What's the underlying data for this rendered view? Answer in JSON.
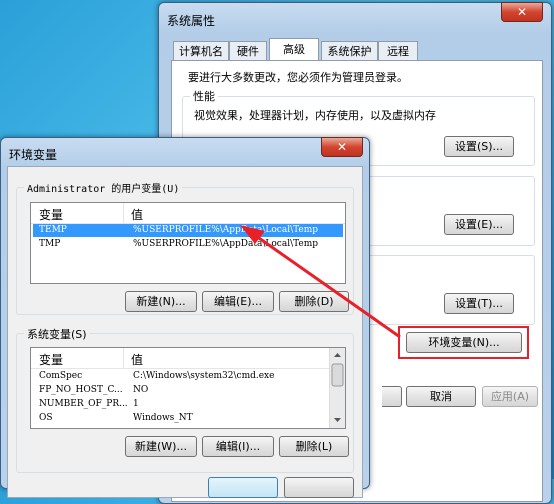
{
  "system_properties": {
    "title": "系统属性",
    "close": "✕",
    "tabs": [
      "计算机名",
      "硬件",
      "高级",
      "系统保护",
      "远程"
    ],
    "admin_notice": "要进行大多数更改，您必须作为管理员登录。",
    "performance": {
      "label": "性能",
      "description": "视觉效果，处理器计划，内存使用，以及虚拟内存",
      "settings_button": "设置(S)..."
    },
    "user_profiles": {
      "settings_button": "设置(E)..."
    },
    "startup_recovery": {
      "settings_button": "设置(T)..."
    },
    "env_vars_button": "环境变量(N)...",
    "cancel_button": "取消",
    "apply_button": "应用(A)"
  },
  "env_dialog": {
    "title": "环境变量",
    "close": "✕",
    "user_group_label": "Administrator 的用户变量(U)",
    "columns": [
      "变量",
      "值"
    ],
    "user_vars": [
      {
        "name": "TEMP",
        "value": "%USERPROFILE%\\AppData\\Local\\Temp",
        "selected": true
      },
      {
        "name": "TMP",
        "value": "%USERPROFILE%\\AppData\\Local\\Temp",
        "selected": false
      }
    ],
    "user_buttons": {
      "new": "新建(N)...",
      "edit": "编辑(E)...",
      "delete": "删除(D)"
    },
    "system_group_label": "系统变量(S)",
    "system_vars": [
      {
        "name": "ComSpec",
        "value": "C:\\Windows\\system32\\cmd.exe"
      },
      {
        "name": "FP_NO_HOST_C...",
        "value": "NO"
      },
      {
        "name": "NUMBER_OF_PR...",
        "value": "1"
      },
      {
        "name": "OS",
        "value": "Windows_NT"
      }
    ],
    "system_buttons": {
      "new": "新建(W)...",
      "edit": "编辑(I)...",
      "delete": "删除(L)"
    }
  },
  "colors": {
    "annotation_arrow": "#e8202a",
    "selection": "#3399ff",
    "highlight_box": "#e8202a"
  }
}
